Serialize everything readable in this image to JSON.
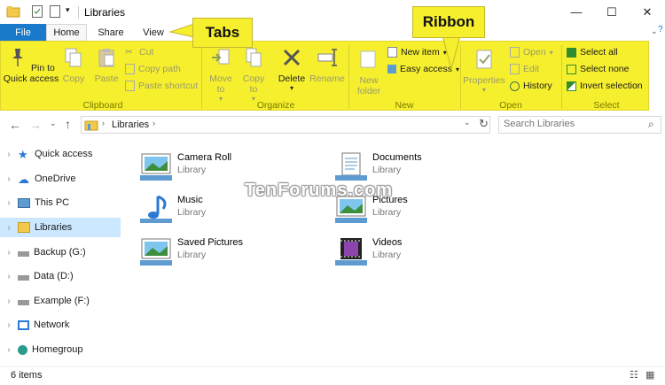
{
  "window": {
    "title": "Libraries",
    "minimize_glyph": "—",
    "maximize_glyph": "☐",
    "close_glyph": "✕"
  },
  "tabs": {
    "file": "File",
    "home": "Home",
    "share": "Share",
    "view": "View"
  },
  "callouts": {
    "tabs": "Tabs",
    "ribbon": "Ribbon"
  },
  "ribbon": {
    "clipboard": {
      "label": "Clipboard",
      "pin": "Pin to Quick access",
      "copy": "Copy",
      "paste": "Paste",
      "cut": "Cut",
      "copy_path": "Copy path",
      "paste_shortcut": "Paste shortcut"
    },
    "organize": {
      "label": "Organize",
      "move_to": "Move to",
      "copy_to": "Copy to",
      "delete": "Delete",
      "rename": "Rename"
    },
    "new": {
      "label": "New",
      "new_folder": "New folder",
      "new_item": "New item",
      "easy_access": "Easy access"
    },
    "open": {
      "label": "Open",
      "properties": "Properties",
      "open": "Open",
      "edit": "Edit",
      "history": "History"
    },
    "select": {
      "label": "Select",
      "select_all": "Select all",
      "select_none": "Select none",
      "invert_selection": "Invert selection"
    }
  },
  "address": {
    "crumb": "Libraries",
    "search_placeholder": "Search Libraries"
  },
  "nav": {
    "items": [
      {
        "label": "Quick access",
        "icon": "star-icon"
      },
      {
        "label": "OneDrive",
        "icon": "cloud-icon"
      },
      {
        "label": "This PC",
        "icon": "computer-icon"
      },
      {
        "label": "Libraries",
        "icon": "library-icon",
        "selected": true
      },
      {
        "label": "Backup (G:)",
        "icon": "drive-icon"
      },
      {
        "label": "Data (D:)",
        "icon": "drive-icon"
      },
      {
        "label": "Example (F:)",
        "icon": "drive-icon"
      },
      {
        "label": "Network",
        "icon": "network-icon"
      },
      {
        "label": "Homegroup",
        "icon": "homegroup-icon"
      }
    ]
  },
  "libraries": [
    {
      "name": "Camera Roll",
      "type": "Library",
      "icon": "image-library-icon"
    },
    {
      "name": "Documents",
      "type": "Library",
      "icon": "documents-library-icon"
    },
    {
      "name": "Music",
      "type": "Library",
      "icon": "music-library-icon"
    },
    {
      "name": "Pictures",
      "type": "Library",
      "icon": "pictures-library-icon"
    },
    {
      "name": "Saved Pictures",
      "type": "Library",
      "icon": "image-library-icon"
    },
    {
      "name": "Videos",
      "type": "Library",
      "icon": "videos-library-icon"
    }
  ],
  "status": {
    "count": "6 items"
  },
  "watermark": "TenForums.com",
  "colors": {
    "accent": "#1979ca",
    "ribbon_highlight": "#f6ef2e",
    "selection": "#cce8ff"
  }
}
